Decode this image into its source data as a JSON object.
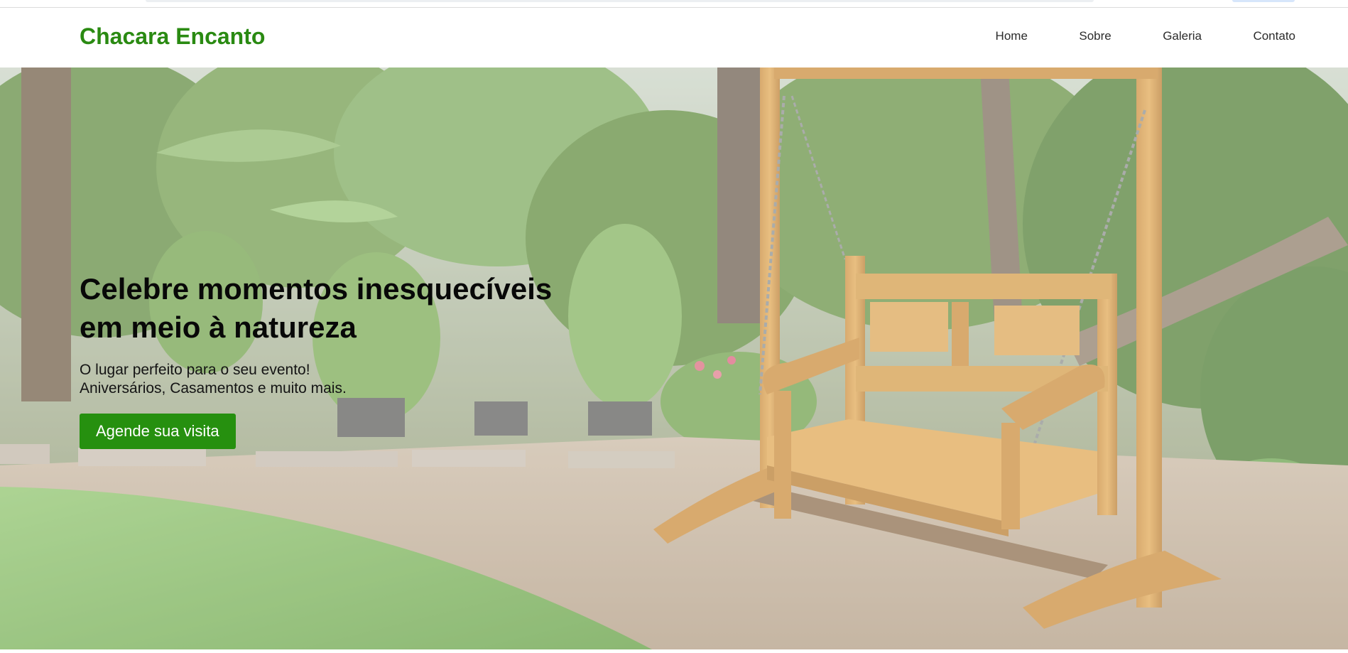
{
  "brand": {
    "name": "Chacara Encanto",
    "color": "#2a8a12"
  },
  "nav": {
    "items": [
      {
        "label": "Home"
      },
      {
        "label": "Sobre"
      },
      {
        "label": "Galeria"
      },
      {
        "label": "Contato"
      }
    ]
  },
  "hero": {
    "title_line1": "Celebre momentos inesquecíveis",
    "title_line2": "em meio à natureza",
    "subtitle_line1": "O lugar perfeito para o seu evento!",
    "subtitle_line2": "Aniversários, Casamentos e muito mais.",
    "cta_label": "Agende sua visita",
    "cta_color": "#26900f",
    "background_image": "garden-swing-bench-photo"
  }
}
